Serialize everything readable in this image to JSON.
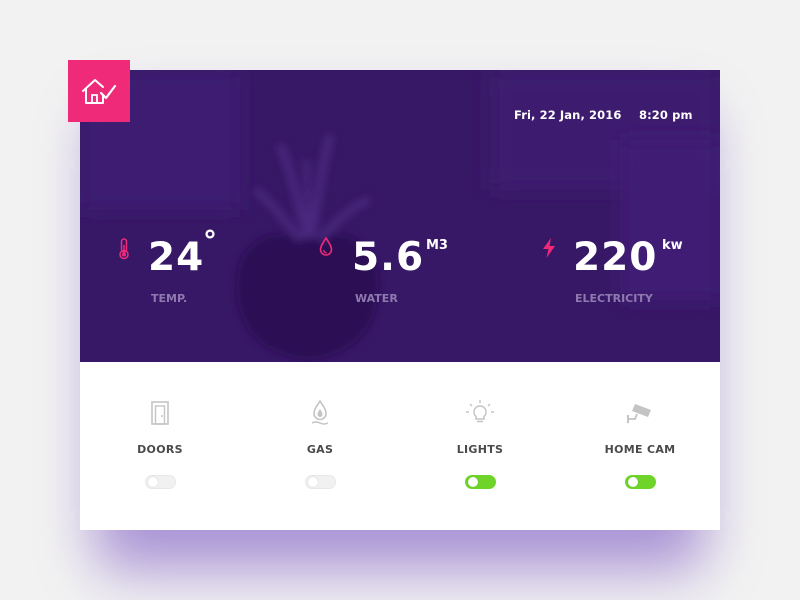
{
  "app": {
    "logo_icon": "home-check-icon",
    "accent_color": "#ef2a78",
    "hero_color": "#3a1a6a",
    "toggle_on_color": "#6ed42a"
  },
  "header": {
    "date": "Fri, 22 Jan, 2016",
    "time": "8:20 pm"
  },
  "stats": [
    {
      "icon": "thermometer-icon",
      "value": "24",
      "unit": "°",
      "label": "TEMP."
    },
    {
      "icon": "water-drop-icon",
      "value": "5.6",
      "unit": "M3",
      "label": "WATER"
    },
    {
      "icon": "lightning-icon",
      "value": "220",
      "unit": "kw",
      "label": "ELECTRICITY"
    }
  ],
  "controls": [
    {
      "icon": "door-icon",
      "label": "DOORS",
      "on": false
    },
    {
      "icon": "gas-flame-icon",
      "label": "GAS",
      "on": false
    },
    {
      "icon": "light-bulb-icon",
      "label": "LIGHTS",
      "on": true
    },
    {
      "icon": "security-camera-icon",
      "label": "HOME CAM",
      "on": true
    }
  ]
}
